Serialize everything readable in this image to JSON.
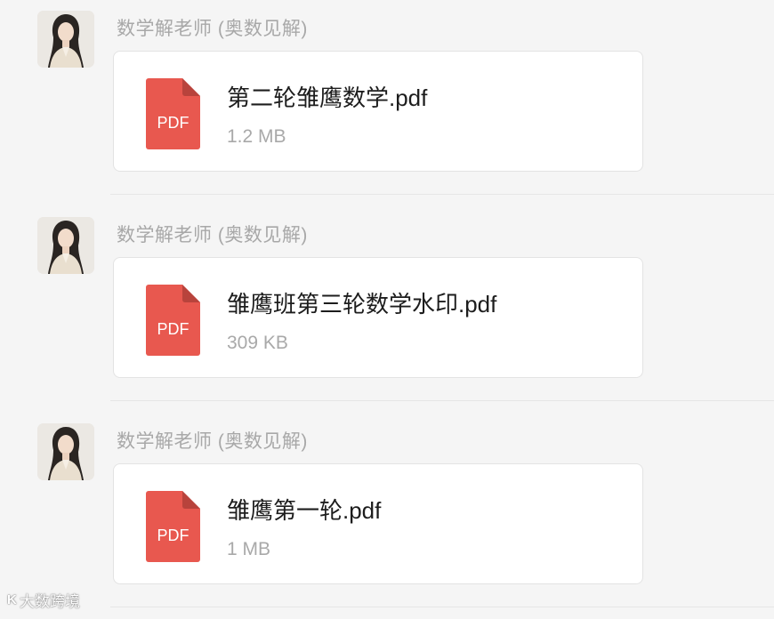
{
  "messages": [
    {
      "sender": "数学解老师 (奥数见解)",
      "file": {
        "name": "第二轮雏鹰数学.pdf",
        "size": "1.2 MB",
        "type_label": "PDF"
      }
    },
    {
      "sender": "数学解老师 (奥数见解)",
      "file": {
        "name": "雏鹰班第三轮数学水印.pdf",
        "size": "309 KB",
        "type_label": "PDF"
      }
    },
    {
      "sender": "数学解老师 (奥数见解)",
      "file": {
        "name": "雏鹰第一轮.pdf",
        "size": "1 MB",
        "type_label": "PDF"
      }
    }
  ],
  "watermark": {
    "logo": "K",
    "text": "大数跨境"
  },
  "colors": {
    "pdf_icon": "#e8584f",
    "pdf_fold": "#b8433c",
    "background": "#f5f5f5",
    "card": "#ffffff"
  }
}
